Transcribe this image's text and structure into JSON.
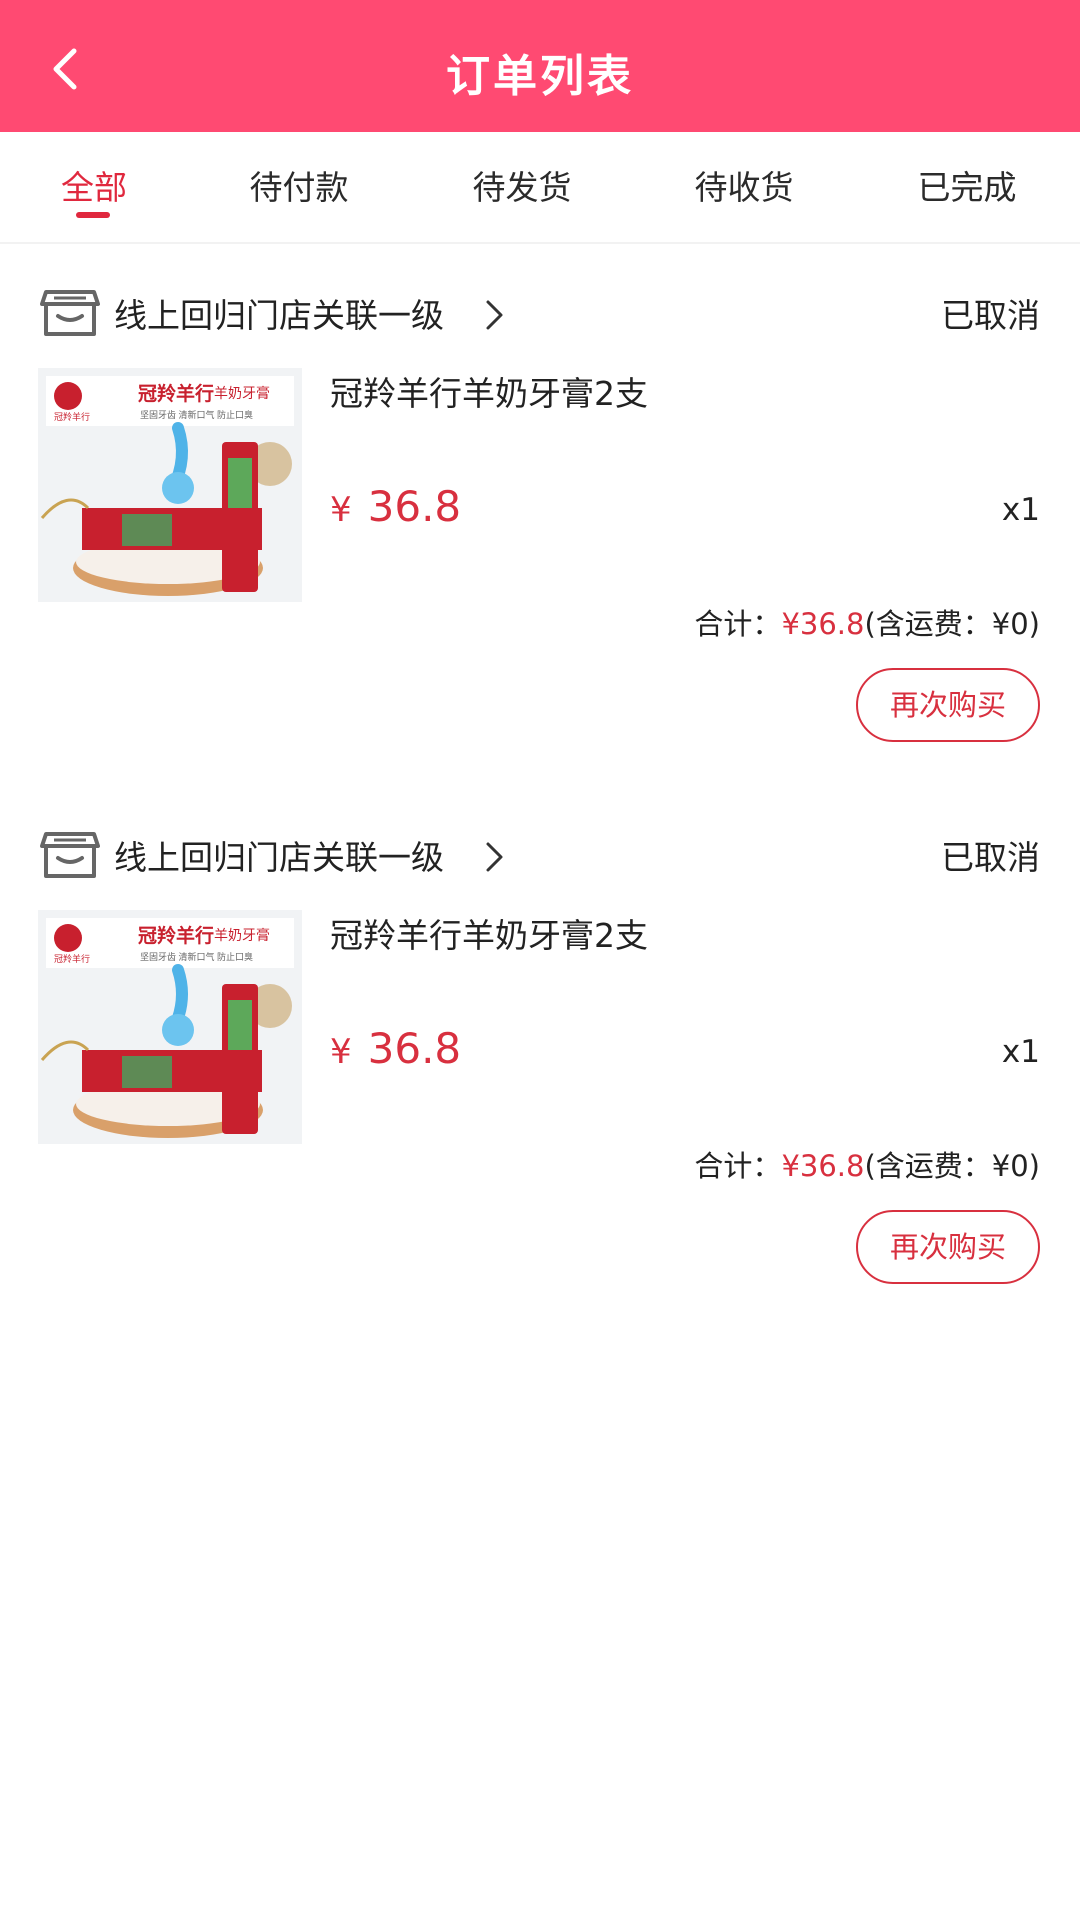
{
  "header": {
    "title": "订单列表",
    "back_icon": "chevron-left-icon",
    "background": "#ff4a72"
  },
  "tabs": [
    {
      "label": "全部",
      "active": true
    },
    {
      "label": "待付款",
      "active": false
    },
    {
      "label": "待发货",
      "active": false
    },
    {
      "label": "待收货",
      "active": false
    },
    {
      "label": "已完成",
      "active": false
    }
  ],
  "accent_color": "#d8303f",
  "orders": [
    {
      "store_name": "线上回归门店关联一级",
      "store_icon": "store-icon",
      "status": "已取消",
      "product": {
        "name": "冠羚羊行羊奶牙膏2支",
        "image": "toothpaste-product-image",
        "currency": "¥",
        "price": "36.8",
        "quantity": "x1",
        "image_text": {
          "brand_title": "冠羚羊行",
          "subtitle": "羊奶牙膏",
          "slogan": "坚固牙齿  清新口气  防止口臭",
          "logo_text": "冠羚羊行"
        }
      },
      "total_label": "合计：",
      "total_amount": "¥36.8",
      "shipping_text": "(含运费：¥0)",
      "rebuy_label": "再次购买"
    },
    {
      "store_name": "线上回归门店关联一级",
      "store_icon": "store-icon",
      "status": "已取消",
      "product": {
        "name": "冠羚羊行羊奶牙膏2支",
        "image": "toothpaste-product-image",
        "currency": "¥",
        "price": "36.8",
        "quantity": "x1",
        "image_text": {
          "brand_title": "冠羚羊行",
          "subtitle": "羊奶牙膏",
          "slogan": "坚固牙齿  清新口气  防止口臭",
          "logo_text": "冠羚羊行"
        }
      },
      "total_label": "合计：",
      "total_amount": "¥36.8",
      "shipping_text": "(含运费：¥0)",
      "rebuy_label": "再次购买"
    }
  ]
}
